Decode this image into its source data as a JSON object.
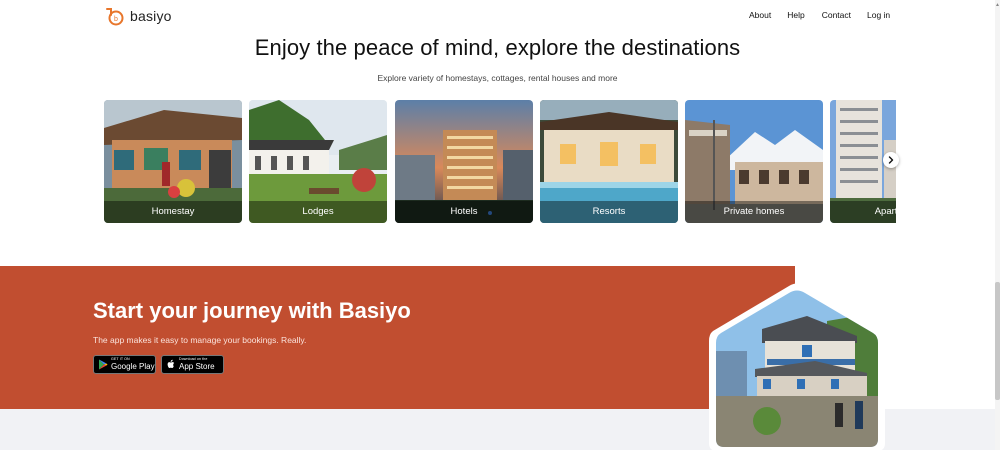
{
  "header": {
    "logo_text": "basiyo",
    "nav": [
      "About",
      "Help",
      "Contact",
      "Log in"
    ]
  },
  "hero": {
    "title": "Enjoy the peace of mind, explore the destinations",
    "subtitle": "Explore variety of homestays, cottages, rental houses and more"
  },
  "categories": [
    "Homestay",
    "Lodges",
    "Hotels",
    "Resorts",
    "Private homes",
    "Apartments"
  ],
  "journey": {
    "title": "Start your journey with Basiyo",
    "subtitle": "The app makes it easy to manage your bookings. Really.",
    "google_play_small": "GET IT ON",
    "google_play_big": "Google Play",
    "app_store_small": "Download on the",
    "app_store_big": "App Store"
  },
  "colors": {
    "brand_orange": "#e8762b",
    "journey_bg": "#c14e30",
    "footer_band": "#f1f2f5"
  },
  "icons": [
    "logo-icon",
    "chevron-right-icon",
    "google-play-icon",
    "apple-icon"
  ]
}
